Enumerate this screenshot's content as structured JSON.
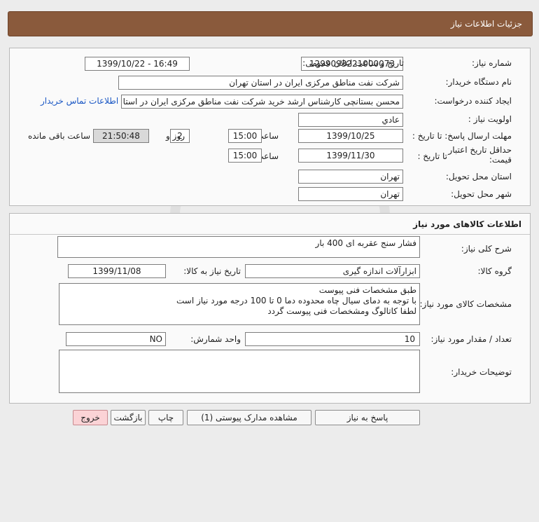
{
  "header": {
    "title": "جزئیات اطلاعات نیاز"
  },
  "need_info": {
    "need_number_label": "شماره نیاز:",
    "need_number": "1299093221000073",
    "announce_label": "تاریخ و ساعت اعلان عمومی:",
    "announce_value": "1399/10/22 - 16:49",
    "buyer_org_label": "نام دستگاه خریدار:",
    "buyer_org": "شرکت نفت مناطق مرکزی ایران در استان تهران",
    "requester_label": "ایجاد کننده درخواست:",
    "requester": "محسن بستانچی کارشناس ارشد خرید شرکت نفت مناطق مرکزی ایران در استا",
    "buyer_contact_link": "اطلاعات تماس خریدار",
    "priority_label": "اولویت نیاز :",
    "priority": "عادي",
    "deadline_label": "مهلت ارسال پاسخ: تا تاریخ :",
    "deadline_date": "1399/10/25",
    "time_label": "ساعت",
    "deadline_time": "15:00",
    "days_count": "2",
    "days_label": "روز و",
    "remaining_time": "21:50:48",
    "remaining_label": "ساعت باقی مانده",
    "validity_label": "حداقل تاریخ اعتبار قیمت:",
    "validity_to_label": "تا تاریخ :",
    "validity_date": "1399/11/30",
    "validity_time_label": "ساعت",
    "validity_time": "15:00",
    "province_label": "استان محل تحویل:",
    "province": "تهران",
    "city_label": "شهر محل تحویل:",
    "city": "تهران"
  },
  "goods": {
    "section_title": "اطلاعات کالاهای مورد نیاز",
    "summary_label": "شرح کلی نیاز:",
    "summary": "فشار سنج عقربه ای 400  بار",
    "group_label": "گروه کالا:",
    "group": "ابزارآلات اندازه گیری",
    "need_date_label": "تاریخ نیاز به کالا:",
    "need_date": "1399/11/08",
    "specs_label": "مشخصات کالای مورد نیاز:",
    "specs_lines": [
      "طبق مشخصات فنی پیوست",
      "با توجه به دمای سیال چاه محدوده دما 0 تا 100 درجه مورد نیاز است",
      "لطفا کاتالوگ ومشخصات فنی پیوست گردد"
    ],
    "qty_label": "تعداد / مقدار مورد نیاز:",
    "qty": "10",
    "unit_label": "واحد شمارش:",
    "unit": "NO",
    "buyer_notes_label": "توضیحات خریدار:",
    "buyer_notes": ""
  },
  "buttons": {
    "reply": "پاسخ به نیاز",
    "attachments": "مشاهده مدارک پیوستی (1)",
    "print": "چاپ",
    "back": "بازگشت",
    "exit": "خروج"
  },
  "colors": {
    "titlebar": "#8a5a3c",
    "link": "#1a57c4",
    "exit_button": "#fbd3d6"
  }
}
